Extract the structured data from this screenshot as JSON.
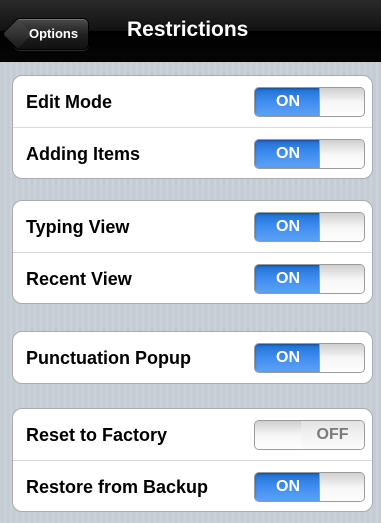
{
  "navbar": {
    "back_label": "Options",
    "title": "Restrictions"
  },
  "groups": [
    {
      "rows": [
        {
          "label": "Edit Mode",
          "toggle_label": "ON",
          "state": "on"
        },
        {
          "label": "Adding Items",
          "toggle_label": "ON",
          "state": "on"
        }
      ]
    },
    {
      "rows": [
        {
          "label": "Typing View",
          "toggle_label": "ON",
          "state": "on"
        },
        {
          "label": "Recent View",
          "toggle_label": "ON",
          "state": "on"
        }
      ]
    },
    {
      "rows": [
        {
          "label": "Punctuation Popup",
          "toggle_label": "ON",
          "state": "on"
        }
      ]
    },
    {
      "rows": [
        {
          "label": "Reset to Factory",
          "toggle_label": "OFF",
          "state": "off"
        },
        {
          "label": "Restore from Backup",
          "toggle_label": "ON",
          "state": "on"
        }
      ]
    }
  ],
  "colors": {
    "toggle_on": "#3d8bf0",
    "background": "#c5ccd4",
    "navbar": "#121212"
  }
}
